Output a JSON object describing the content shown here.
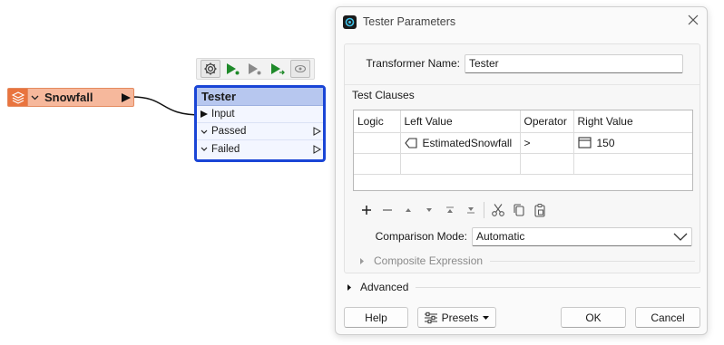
{
  "canvas": {
    "reader": {
      "name": "Snowfall"
    },
    "tester_node": {
      "title": "Tester",
      "ports": [
        {
          "label": "Input",
          "type": "input"
        },
        {
          "label": "Passed",
          "type": "output"
        },
        {
          "label": "Failed",
          "type": "output"
        }
      ]
    },
    "toolbar_icons": [
      "gear-icon",
      "run-to-here-icon",
      "run-this-icon",
      "run-from-here-icon",
      "inspect-cache-icon"
    ]
  },
  "dialog": {
    "title": "Tester Parameters",
    "transformer_name_label": "Transformer Name:",
    "transformer_name_value": "Tester",
    "test_clauses_label": "Test Clauses",
    "columns": [
      "Logic",
      "Left Value",
      "Operator",
      "Right Value"
    ],
    "rows": [
      {
        "logic": "",
        "left_value": "EstimatedSnowfall",
        "operator": ">",
        "right_value": "150"
      },
      {
        "logic": "",
        "left_value": "",
        "operator": "",
        "right_value": ""
      }
    ],
    "comparison_mode_label": "Comparison Mode:",
    "comparison_mode_value": "Automatic",
    "composite_expression_label": "Composite Expression",
    "advanced_label": "Advanced",
    "buttons": {
      "help": "Help",
      "presets": "Presets",
      "ok": "OK",
      "cancel": "Cancel"
    }
  },
  "colors": {
    "reader_fill": "#f6b89c",
    "reader_icon": "#e9743e",
    "tester_border": "#1a45d6",
    "tester_header": "#b7c7ef",
    "run_green": "#1f8a2a"
  }
}
